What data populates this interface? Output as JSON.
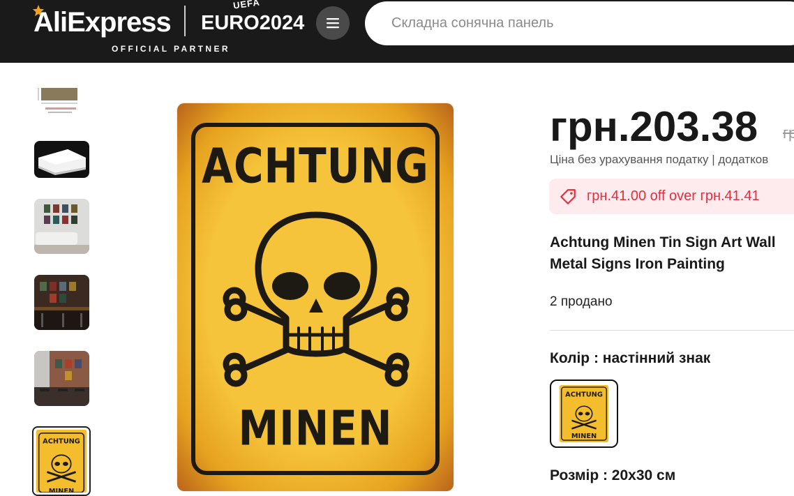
{
  "header": {
    "brand": "AliExpress",
    "event": "EURO2024",
    "event_sub": "UEFA",
    "partner": "OFFICIAL PARTNER",
    "search_placeholder": "Складна сонячна панель"
  },
  "gallery": {
    "thumbnails": [
      "dimensions",
      "sign-side",
      "living-room",
      "bar-wall",
      "cafe-wall",
      "achtung-sign"
    ],
    "main_image": {
      "line1": "ACHTUNG",
      "line2": "MINEN"
    }
  },
  "product": {
    "price": "грн.203.38",
    "old_price": "гр",
    "tax_note": "Ціна без урахування податку | додатков",
    "coupon": "грн.41.00 off over грн.41.41",
    "title_line1": "Achtung Minen Tin Sign Art Wall",
    "title_line2": "Metal Signs Iron Painting",
    "sold": "2 продано",
    "color_label": "Колір : настінний знак",
    "size_label": "Розмір : 20x30 см",
    "swatch_line1": "ACHTUNG",
    "swatch_line2": "MINEN"
  },
  "colors": {
    "header_bg": "#1a1a1a",
    "coupon_bg": "#fdebee",
    "coupon_text": "#e52d3d",
    "sign_yellow": "#f6c43a"
  }
}
